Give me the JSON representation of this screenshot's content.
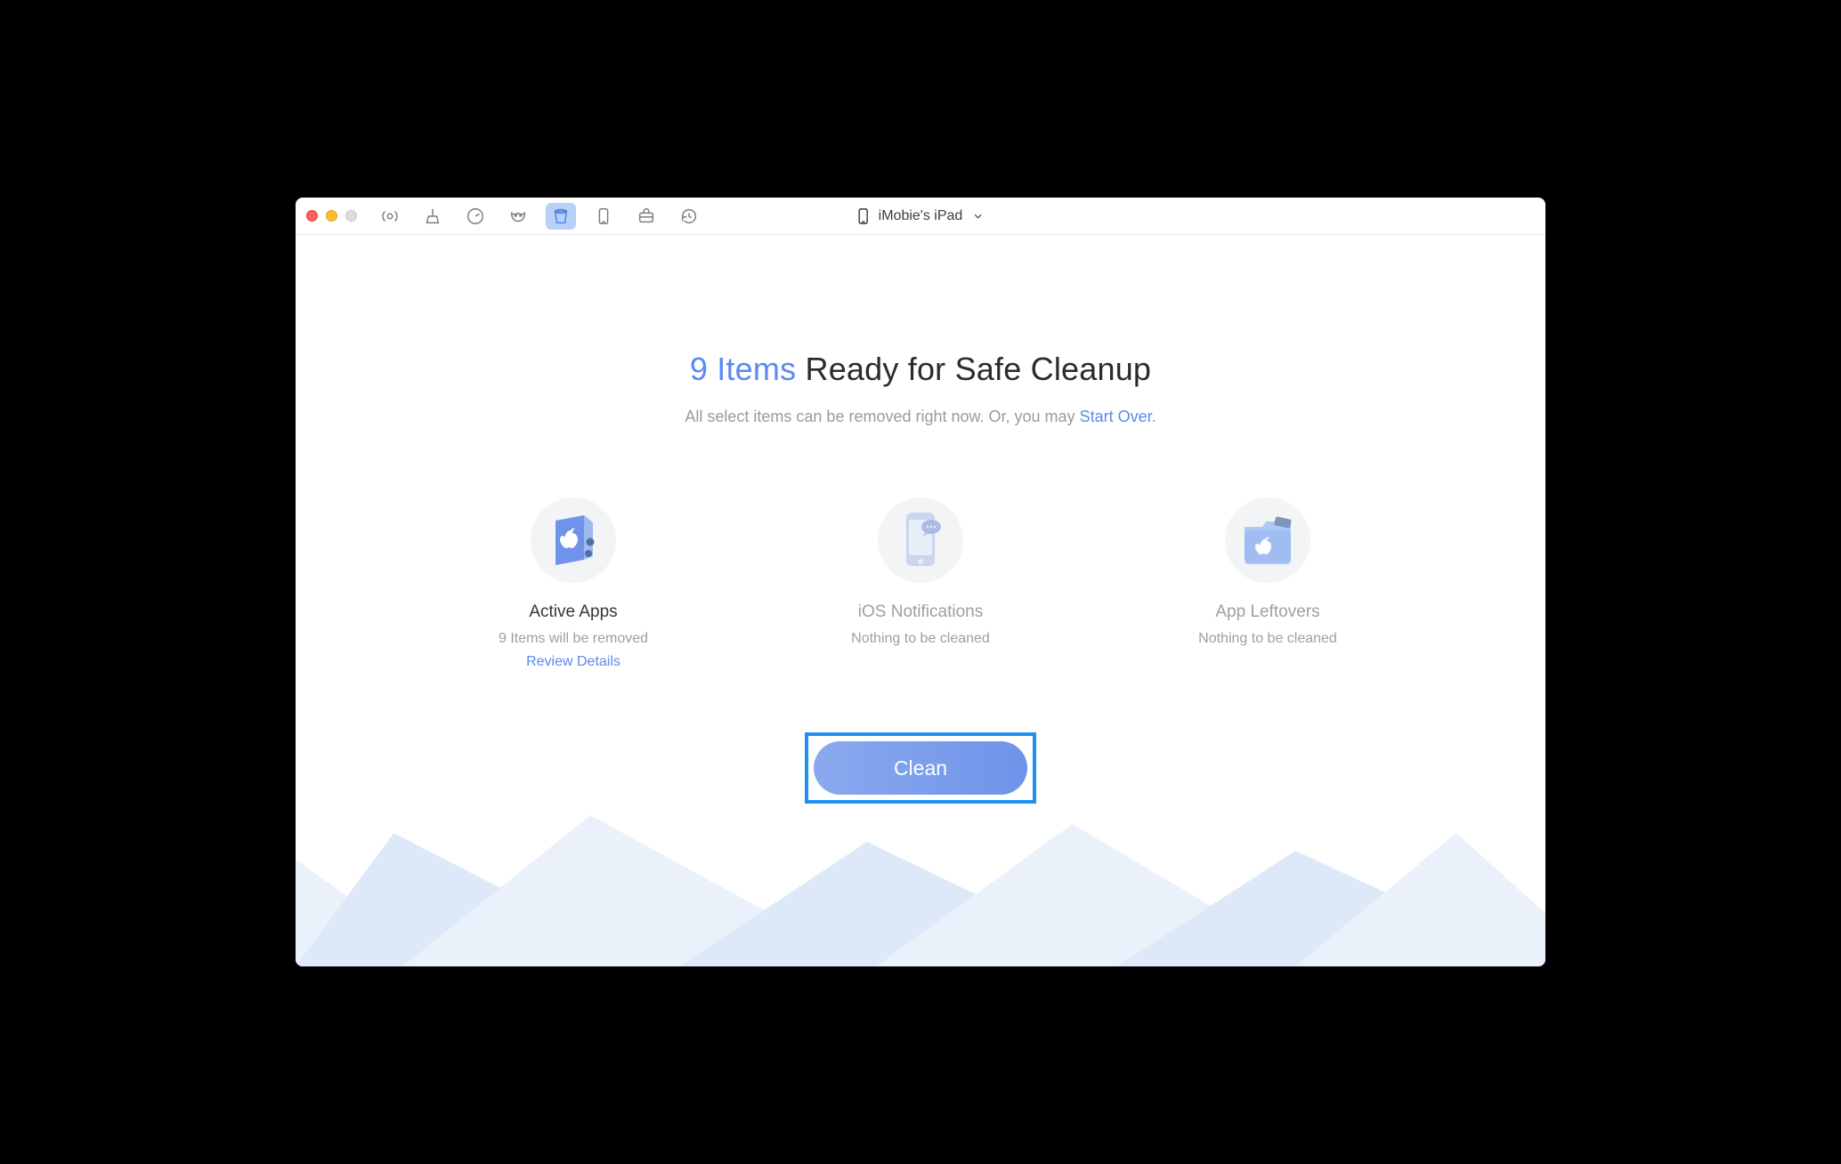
{
  "device": {
    "name": "iMobie's iPad"
  },
  "toolbar": {
    "icons": [
      "airplay",
      "broom",
      "clock-circle",
      "mask",
      "bucket",
      "phone",
      "briefcase",
      "history"
    ],
    "active_index": 4
  },
  "headline": {
    "count": "9 Items",
    "rest": " Ready for Safe Cleanup"
  },
  "subline": {
    "prefix": "All select items can be removed right now. Or, you may ",
    "link": "Start Over",
    "suffix": "."
  },
  "cards": [
    {
      "id": "active-apps",
      "title": "Active Apps",
      "sub": "9 Items will be removed",
      "link": "Review Details",
      "dimmed": false
    },
    {
      "id": "ios-notifications",
      "title": "iOS Notifications",
      "sub": "Nothing to be cleaned",
      "link": "",
      "dimmed": true
    },
    {
      "id": "app-leftovers",
      "title": "App Leftovers",
      "sub": "Nothing to be cleaned",
      "link": "",
      "dimmed": true
    }
  ],
  "clean_button": {
    "label": "Clean"
  },
  "colors": {
    "accent": "#5b8af0",
    "highlight": "#1f91f3",
    "muted": "#9e9ea5"
  }
}
